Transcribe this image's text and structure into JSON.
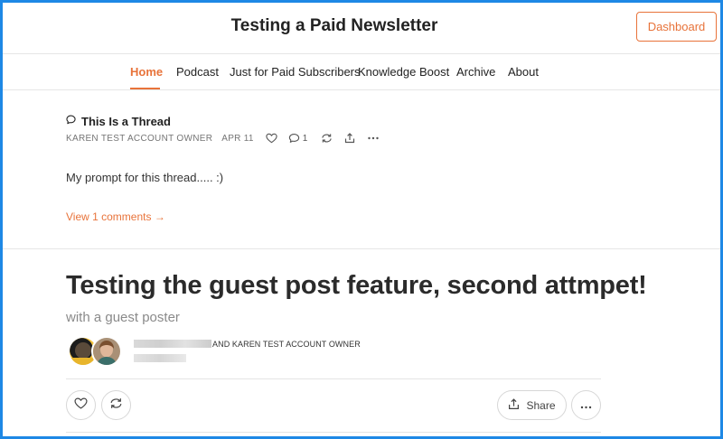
{
  "header": {
    "title": "Testing a Paid Newsletter",
    "dashboard_label": "Dashboard"
  },
  "nav": {
    "items": [
      "Home",
      "Podcast",
      "Just for Paid Subscribers",
      "Knowledge Boost",
      "Archive",
      "About"
    ],
    "active": "Home"
  },
  "thread": {
    "icon": "speech-bubble-icon",
    "title": "This Is a Thread",
    "author": "KAREN TEST ACCOUNT OWNER",
    "date": "APR 11",
    "comment_count": "1",
    "body": "My prompt for this thread..... :)",
    "view_comments": "View 1 comments →"
  },
  "post": {
    "title": "Testing the guest post feature, second attmpet!",
    "subtitle": "with a guest poster",
    "byline_suffix": "AND KAREN TEST ACCOUNT OWNER",
    "share_label": "Share"
  },
  "colors": {
    "accent": "#e8733a",
    "frame": "#1e88e5"
  }
}
